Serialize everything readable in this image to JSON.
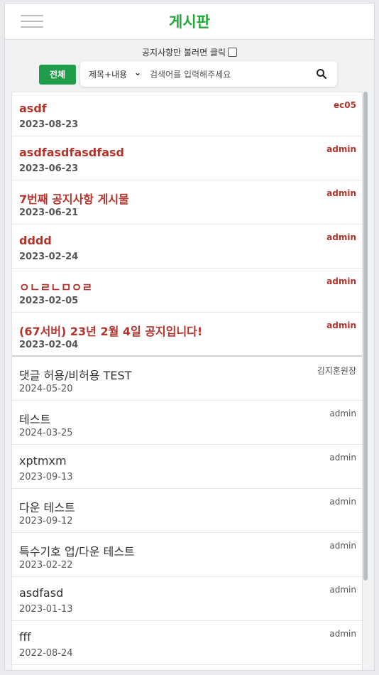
{
  "header": {
    "title": "게시판"
  },
  "filter": {
    "notice_only_label": "공지사항만 불러면 클릭"
  },
  "search": {
    "all_button": "전체",
    "field_select": "제목+내용",
    "placeholder": "검색어를 입력해주세요"
  },
  "notices": [
    {
      "title": "asdf",
      "date": "2023-08-23",
      "author": "ec05"
    },
    {
      "title": "asdfasdfasdfasd",
      "date": "2023-06-23",
      "author": "admin"
    },
    {
      "title": "7번째 공지사항 게시물",
      "date": "2023-06-21",
      "author": "admin"
    },
    {
      "title": "dddd",
      "date": "2023-02-24",
      "author": "admin"
    },
    {
      "title": "ㅇㄴㄹㄴㅁㅇㄹ",
      "date": "2023-02-05",
      "author": "admin"
    },
    {
      "title": "(67서버) 23년 2월 4일 공지입니다!",
      "date": "2023-02-04",
      "author": "admin"
    }
  ],
  "posts": [
    {
      "title": "댓글 허용/비허용 TEST",
      "date": "2024-05-20",
      "author": "김지훈원장"
    },
    {
      "title": "테스트",
      "date": "2024-03-25",
      "author": "admin"
    },
    {
      "title": "xptmxm",
      "date": "2023-09-13",
      "author": "admin"
    },
    {
      "title": "다운 테스트",
      "date": "2023-09-12",
      "author": "admin"
    },
    {
      "title": "특수기호 업/다운 테스트",
      "date": "2023-02-22",
      "author": "admin"
    },
    {
      "title": "asdfasd",
      "date": "2023-01-13",
      "author": "admin"
    },
    {
      "title": "fff",
      "date": "2022-08-24",
      "author": "admin"
    }
  ],
  "colors": {
    "accent": "#20a83a",
    "button": "#1f9d4a",
    "notice": "#b4342b"
  }
}
